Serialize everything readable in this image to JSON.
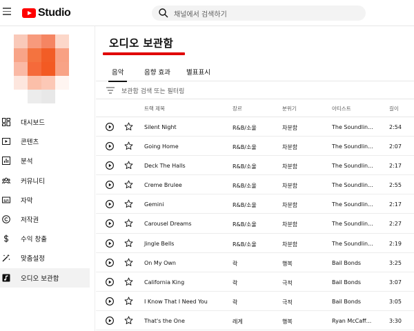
{
  "header": {
    "logo_text": "Studio",
    "search_placeholder": "채널에서 검색하기",
    "brand_color": "#ff0000"
  },
  "sidebar": {
    "items": [
      {
        "label": "대시보드",
        "icon": "dashboard-icon"
      },
      {
        "label": "콘텐츠",
        "icon": "content-icon"
      },
      {
        "label": "분석",
        "icon": "analytics-icon"
      },
      {
        "label": "커뮤니티",
        "icon": "community-icon"
      },
      {
        "label": "자막",
        "icon": "subtitles-icon"
      },
      {
        "label": "저작권",
        "icon": "copyright-icon"
      },
      {
        "label": "수익 창출",
        "icon": "monetization-icon"
      },
      {
        "label": "맞춤설정",
        "icon": "customization-icon"
      },
      {
        "label": "오디오 보관함",
        "icon": "audio-library-icon",
        "active": true
      }
    ]
  },
  "main": {
    "title": "오디오 보관함",
    "accent_color": "#e00000",
    "tabs": [
      {
        "label": "음악",
        "active": true
      },
      {
        "label": "음향 효과"
      },
      {
        "label": "별표표시"
      }
    ],
    "filter_placeholder": "보관함 검색 또는 필터링",
    "columns": {
      "title": "트랙 제목",
      "genre": "장르",
      "mood": "분위기",
      "artist": "아티스트",
      "length": "길이"
    },
    "tracks": [
      {
        "title": "Silent Night",
        "genre": "R&B/소울",
        "mood": "차분함",
        "artist": "The Soundlin...",
        "length": "2:54"
      },
      {
        "title": "Going Home",
        "genre": "R&B/소울",
        "mood": "차분함",
        "artist": "The Soundlin...",
        "length": "2:07"
      },
      {
        "title": "Deck The Halls",
        "genre": "R&B/소울",
        "mood": "차분함",
        "artist": "The Soundlin...",
        "length": "2:17"
      },
      {
        "title": "Creme Brulee",
        "genre": "R&B/소울",
        "mood": "차분함",
        "artist": "The Soundlin...",
        "length": "2:55"
      },
      {
        "title": "Gemini",
        "genre": "R&B/소울",
        "mood": "차분함",
        "artist": "The Soundlin...",
        "length": "2:17"
      },
      {
        "title": "Carousel Dreams",
        "genre": "R&B/소울",
        "mood": "차분함",
        "artist": "The Soundlin...",
        "length": "2:27"
      },
      {
        "title": "Jingle Bells",
        "genre": "R&B/소울",
        "mood": "차분함",
        "artist": "The Soundlin...",
        "length": "2:19"
      },
      {
        "title": "On My Own",
        "genre": "락",
        "mood": "행복",
        "artist": "Bail Bonds",
        "length": "3:25"
      },
      {
        "title": "California King",
        "genre": "락",
        "mood": "극적",
        "artist": "Bail Bonds",
        "length": "3:07"
      },
      {
        "title": "I Know That I Need You",
        "genre": "락",
        "mood": "극적",
        "artist": "Bail Bonds",
        "length": "3:05"
      },
      {
        "title": "That's the One",
        "genre": "레게",
        "mood": "행복",
        "artist": "Ryan McCaff...",
        "length": "3:30"
      }
    ]
  }
}
